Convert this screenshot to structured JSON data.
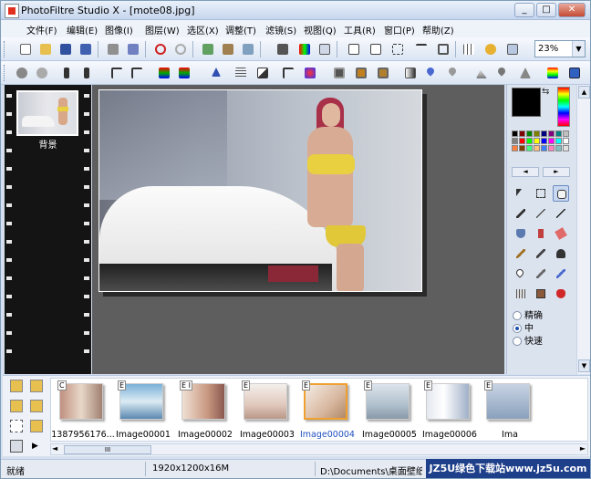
{
  "window": {
    "title": "PhotoFiltre Studio X - [mote08.jpg]",
    "controls": [
      "_",
      "□",
      "✕"
    ]
  },
  "menu": [
    "文件(F)",
    "编辑(E)",
    "图像(I)",
    "图层(W)",
    "选区(X)",
    "调整(T)",
    "滤镜(S)",
    "视图(Q)",
    "工具(R)",
    "窗口(P)",
    "帮助(Z)"
  ],
  "toolbar": {
    "zoom": "23%"
  },
  "layers": {
    "layer_name": "背景"
  },
  "right_panel": {
    "radio_options": [
      "精确",
      "中",
      "快速"
    ],
    "selected_radio": "中"
  },
  "browser": {
    "thumbnails": [
      {
        "caption": "1387956176...",
        "tag": "C"
      },
      {
        "caption": "Image00001",
        "tag": "E"
      },
      {
        "caption": "Image00002",
        "tag": "E I"
      },
      {
        "caption": "Image00003",
        "tag": "E"
      },
      {
        "caption": "Image00004",
        "tag": "E",
        "selected": true
      },
      {
        "caption": "Image00005",
        "tag": "E"
      },
      {
        "caption": "Image00006",
        "tag": "E"
      },
      {
        "caption": "Ima",
        "tag": "E"
      }
    ],
    "scroll_thumb": "III"
  },
  "status": {
    "state": "就绪",
    "image_info": "1920x1200x16M",
    "path": "D:\\Documents\\桌面壁纸\\美..."
  },
  "watermark": "JZ5U绿色下载站www.jz5u.com",
  "colors": {
    "foreground": "#000000",
    "accent": "#f0a030",
    "titlebar": "#c6d6ee"
  }
}
